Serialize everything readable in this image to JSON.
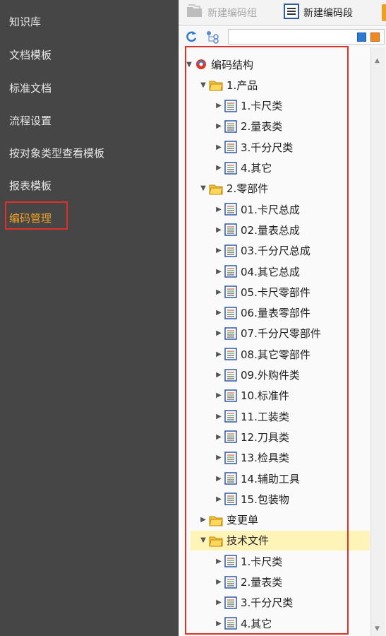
{
  "sidebar": {
    "items": [
      "知识库",
      "文档模板",
      "标准文档",
      "流程设置",
      "按对象类型查看模板",
      "报表模板",
      "编码管理"
    ],
    "active_index": 6,
    "colors": {
      "bg": "#464646",
      "text": "#e8e8e8",
      "active": "#f0a020",
      "highlight_border": "#e0302a"
    }
  },
  "toolbar": {
    "new_group_label": "新建编码组",
    "new_segment_label": "新建编码段"
  },
  "tree": {
    "root_label": "编码结构",
    "groups": [
      {
        "label": "1.产品",
        "expanded": true,
        "children": [
          "1.卡尺类",
          "2.量表类",
          "3.千分尺类",
          "4.其它"
        ]
      },
      {
        "label": "2.零部件",
        "expanded": true,
        "children": [
          "01.卡尺总成",
          "02.量表总成",
          "03.千分尺总成",
          "04.其它总成",
          "05.卡尺零部件",
          "06.量表零部件",
          "07.千分尺零部件",
          "08.其它零部件",
          "09.外购件类",
          "10.标准件",
          "11.工装类",
          "12.刀具类",
          "13.检具类",
          "14.辅助工具",
          "15.包装物"
        ]
      },
      {
        "label": "变更单",
        "expanded": false,
        "children": []
      },
      {
        "label": "技术文件",
        "expanded": true,
        "selected": true,
        "children": [
          "1.卡尺类",
          "2.量表类",
          "3.千分尺类",
          "4.其它"
        ]
      }
    ]
  }
}
